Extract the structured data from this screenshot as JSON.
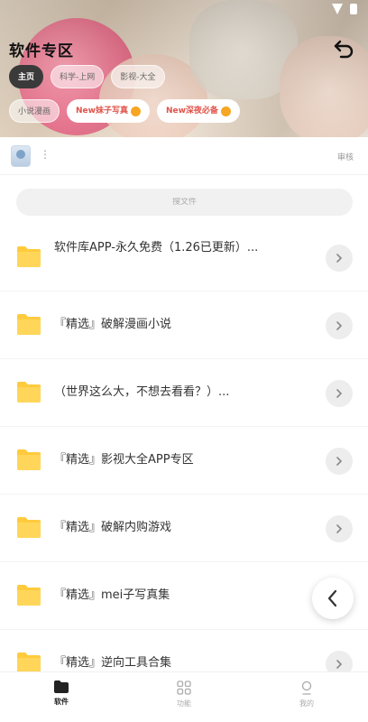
{
  "header": {
    "title": "软件专区",
    "chips_row1": [
      "主页",
      "科学-上网",
      "影视-大全"
    ],
    "chips_row2": [
      {
        "label": "小说漫画",
        "promo": false
      },
      {
        "label": "New妹子写真",
        "promo": true
      },
      {
        "label": "New深夜必备",
        "promo": true
      }
    ]
  },
  "user": {
    "dots": "⋮",
    "right_text": "审核"
  },
  "search": {
    "placeholder": "搜文件"
  },
  "list": {
    "items": [
      {
        "label": "软件库APP-永久免费（1.26已更新）..."
      },
      {
        "label": "『精选』破解漫画小说"
      },
      {
        "label": "（世界这么大，不想去看看？）..."
      },
      {
        "label": "『精选』影视大全APP专区"
      },
      {
        "label": "『精选』破解内购游戏"
      },
      {
        "label": "『精选』mei子写真集"
      },
      {
        "label": "『精选』逆向工具合集"
      }
    ]
  },
  "nav": {
    "items": [
      {
        "label": "软件",
        "icon": "folder-icon"
      },
      {
        "label": "功能",
        "icon": "grid-icon"
      },
      {
        "label": "我的",
        "icon": "profile-icon"
      }
    ]
  },
  "colors": {
    "folder": "#FFCB3D",
    "promo_text": "#e0534a",
    "active_chip": "#3a3a3a"
  }
}
